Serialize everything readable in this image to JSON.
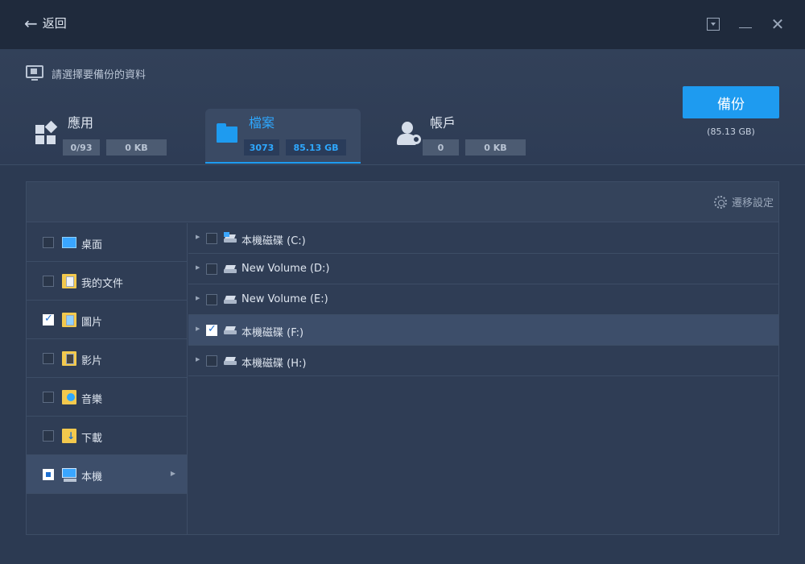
{
  "titlebar": {
    "back_label": "返回"
  },
  "header": {
    "prompt": "請選擇要備份的資料",
    "tabs": [
      {
        "title": "應用",
        "count": "0/93",
        "size": "0 KB"
      },
      {
        "title": "檔案",
        "count": "3073",
        "size": "85.13 GB"
      },
      {
        "title": "帳戶",
        "count": "0",
        "size": "0 KB"
      }
    ],
    "backup_label": "備份",
    "backup_size": "(85.13 GB)"
  },
  "toolbar": {
    "migrate_label": "遷移設定"
  },
  "left_items": [
    {
      "label": "桌面",
      "checked": false
    },
    {
      "label": "我的文件",
      "checked": false
    },
    {
      "label": "圖片",
      "checked": true
    },
    {
      "label": "影片",
      "checked": false
    },
    {
      "label": "音樂",
      "checked": false
    },
    {
      "label": "下載",
      "checked": false
    },
    {
      "label": "本機",
      "checked": "partial"
    }
  ],
  "drives": [
    {
      "label": "本機磁碟 (C:)",
      "checked": false
    },
    {
      "label": "New Volume (D:)",
      "checked": false
    },
    {
      "label": "New Volume (E:)",
      "checked": false
    },
    {
      "label": "本機磁碟 (F:)",
      "checked": true
    },
    {
      "label": "本機磁碟 (H:)",
      "checked": false
    }
  ],
  "colors": {
    "accent": "#1e9bf0",
    "background": "#2c3a52",
    "titlebar": "#1f2a3c"
  }
}
